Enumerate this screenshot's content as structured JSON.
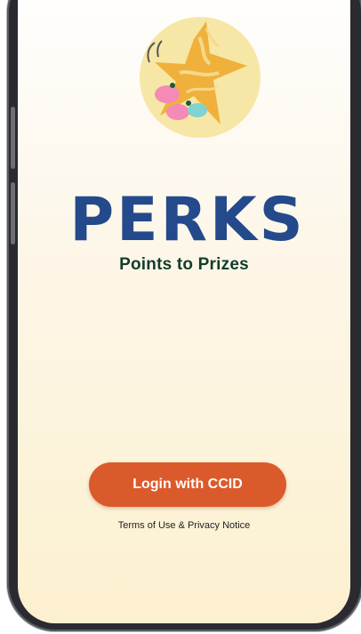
{
  "brand": {
    "logo_text": "PERKS",
    "tagline": "Points to Prizes"
  },
  "actions": {
    "login_label": "Login with CCID"
  },
  "legal": {
    "terms_label": "Terms of Use",
    "separator": " & ",
    "privacy_label": "Privacy Notice"
  },
  "colors": {
    "button": "#db5a2b",
    "tagline": "#133d2b",
    "background_top": "#ffffff",
    "background_bottom": "#fcf0cf"
  },
  "icons": [
    "star-mascot-icon"
  ]
}
